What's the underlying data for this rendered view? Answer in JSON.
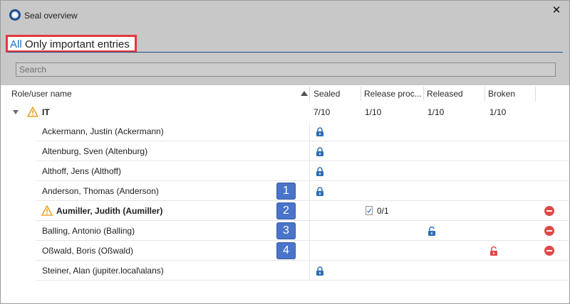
{
  "window": {
    "title": "Seal overview",
    "close_symbol": "✕"
  },
  "filters": {
    "all_label": "All",
    "important_label": "Only important entries"
  },
  "search": {
    "placeholder": "Search"
  },
  "columns": {
    "name": "Role/user name",
    "sealed": "Sealed",
    "release": "Release proc...",
    "released": "Released",
    "broken": "Broken"
  },
  "group": {
    "name": "IT",
    "sealed": "7/10",
    "release": "1/10",
    "released": "1/10",
    "broken": "1/10",
    "icon": "warning-icon"
  },
  "rows": [
    {
      "name": "Ackermann, Justin (Ackermann)",
      "sealed_lock": true
    },
    {
      "name": "Altenburg, Sven (Altenburg)",
      "sealed_lock": true
    },
    {
      "name": "Althoff, Jens (Althoff)",
      "sealed_lock": true
    },
    {
      "name": "Anderson, Thomas (Anderson)",
      "sealed_lock": true,
      "badge": "1"
    },
    {
      "name": "Aumiller, Judith (Aumiller)",
      "bold": true,
      "warning": true,
      "badge": "2",
      "release_value": "0/1",
      "remove": true
    },
    {
      "name": "Balling, Antonio (Balling)",
      "badge": "3",
      "released_lock": true,
      "remove": true
    },
    {
      "name": "Oßwald, Boris (Oßwald)",
      "badge": "4",
      "broken_lock": true,
      "remove": true
    },
    {
      "name": "Steiner, Alan (jupiter.local\\alans)",
      "sealed_lock": true
    }
  ],
  "colors": {
    "accent": "#1f6fc4",
    "highlight_border": "#e5383b",
    "badge": "#4a74c9",
    "lock_blue": "#2f6db5",
    "lock_red": "#e04848",
    "warning": "#f0a22b"
  }
}
